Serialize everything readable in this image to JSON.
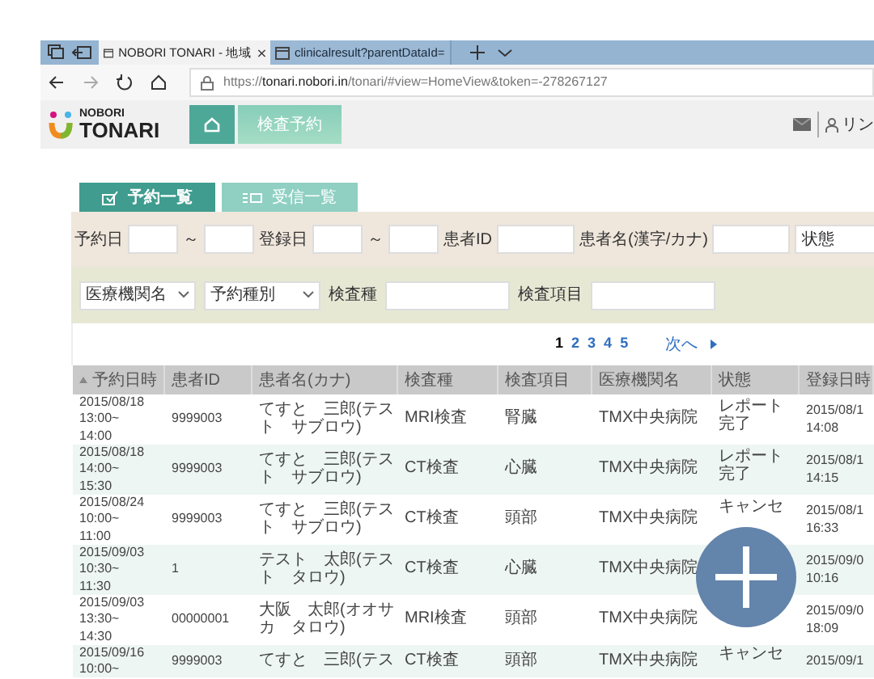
{
  "browser": {
    "tabs": [
      {
        "title": "NOBORI TONARI - 地域",
        "selected": true
      },
      {
        "title": "clinicalresult?parentDataId=",
        "selected": false
      }
    ],
    "address": "https://**tonari.nobori.in**/tonari/#view=HomeView&token=-278267127"
  },
  "app": {
    "logo_top": "NOBORI",
    "logo_bottom": "TONARI",
    "nav": [
      {
        "label": "検査予約"
      }
    ],
    "user": "リン"
  },
  "tabs": [
    {
      "label": "予約一覧",
      "selected": true
    },
    {
      "label": "受信一覧",
      "selected": false
    }
  ],
  "filters": {
    "row_1": [
      {
        "kind": "label",
        "text": "予約日"
      },
      {
        "kind": "date_input"
      },
      {
        "kind": "separator",
        "text": "～"
      },
      {
        "kind": "date_input"
      },
      {
        "kind": "label",
        "text": "登録日"
      },
      {
        "kind": "date_input"
      },
      {
        "kind": "separator",
        "text": "～"
      },
      {
        "kind": "date_input"
      },
      {
        "kind": "label",
        "text": "患者ID"
      },
      {
        "kind": "text_input"
      },
      {
        "kind": "label",
        "text": "患者名(漢字/カナ)"
      },
      {
        "kind": "text_input"
      },
      {
        "kind": "select",
        "text": "状態"
      }
    ],
    "row_2": [
      {
        "kind": "select",
        "text": "医療機関名"
      },
      {
        "kind": "select",
        "text": "予約種別"
      },
      {
        "kind": "label",
        "text": "検査種"
      },
      {
        "kind": "wide_input"
      },
      {
        "kind": "label",
        "text": "検査項目"
      },
      {
        "kind": "wide_input"
      }
    ]
  },
  "pagination": {
    "pages": [
      {
        "label": "1",
        "selected": true
      },
      {
        "label": "2",
        "selected": false
      },
      {
        "label": "3",
        "selected": false
      },
      {
        "label": "4",
        "selected": false
      },
      {
        "label": "5",
        "selected": false
      }
    ],
    "next": "次へ"
  },
  "table": {
    "columns": [
      {
        "label": "予約日時",
        "sorted": true
      },
      {
        "label": "患者ID",
        "sorted": false
      },
      {
        "label": "患者名(カナ)",
        "sorted": false
      },
      {
        "label": "検査種",
        "sorted": false
      },
      {
        "label": "検査項目",
        "sorted": false
      },
      {
        "label": "医療機関名",
        "sorted": false
      },
      {
        "label": "状態",
        "sorted": false
      },
      {
        "label": "登録日時",
        "sorted": false
      }
    ],
    "rows": [
      {
        "date": [
          "2015/08/18",
          "13:00~",
          "14:00"
        ],
        "patient_id": "9999003",
        "name": [
          "てすと　三郎(テス",
          "ト　サブロウ)"
        ],
        "exam_type": "MRI検査",
        "exam_item": "腎臓",
        "facility": "TMX中央病院",
        "status": [
          "レポート",
          "完了"
        ],
        "registered": [
          "2015/08/1",
          "14:08"
        ]
      },
      {
        "date": [
          "2015/08/18",
          "14:00~",
          "15:30"
        ],
        "patient_id": "9999003",
        "name": [
          "てすと　三郎(テス",
          "ト　サブロウ)"
        ],
        "exam_type": "CT検査",
        "exam_item": "心臓",
        "facility": "TMX中央病院",
        "status": [
          "レポート",
          "完了"
        ],
        "registered": [
          "2015/08/1",
          "14:15"
        ]
      },
      {
        "date": [
          "2015/08/24",
          "10:00~",
          "11:00"
        ],
        "patient_id": "9999003",
        "name": [
          "てすと　三郎(テス",
          "ト　サブロウ)"
        ],
        "exam_type": "CT検査",
        "exam_item": "頭部",
        "facility": "TMX中央病院",
        "status": [
          "キャンセ"
        ],
        "registered": [
          "2015/08/1",
          "16:33"
        ]
      },
      {
        "date": [
          "2015/09/03",
          "10:30~",
          "11:30"
        ],
        "patient_id": "1",
        "name": [
          "テスト　太郎(テス",
          "ト　タロウ)"
        ],
        "exam_type": "CT検査",
        "exam_item": "心臓",
        "facility": "TMX中央病院",
        "registered": [
          "2015/09/0",
          "10:16"
        ]
      },
      {
        "date": [
          "2015/09/03",
          "13:30~",
          "14:30"
        ],
        "patient_id": "00000001",
        "name": [
          "大阪　太郎(オオサ",
          "カ　タロウ)"
        ],
        "exam_type": "MRI検査",
        "exam_item": "頭部",
        "facility": "TMX中央病院",
        "registered": [
          "2015/09/0",
          "18:09"
        ]
      },
      {
        "date": [
          "2015/09/16",
          "10:00~"
        ],
        "patient_id": "9999003",
        "name": [
          "てすと　三郎(テス"
        ],
        "exam_type": "CT検査",
        "exam_item": "頭部",
        "facility": "TMX中央病院",
        "status": [
          "キャンセ"
        ],
        "registered": [
          "2015/09/1"
        ]
      }
    ]
  }
}
